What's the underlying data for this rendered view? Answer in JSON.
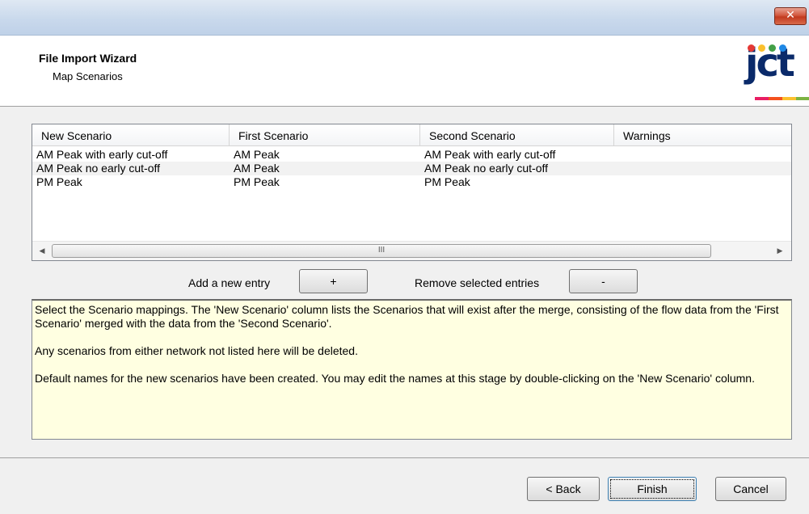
{
  "window": {
    "close_glyph": "✕"
  },
  "header": {
    "title": "File Import Wizard",
    "subtitle": "Map Scenarios"
  },
  "logo": {
    "text": "jct",
    "dot_colors": [
      "#e53935",
      "#fbc02d",
      "#43a047",
      "#1e88e5"
    ],
    "bar_colors": [
      "#e91e63",
      "#f4511e",
      "#fbc02d",
      "#7cb342"
    ]
  },
  "grid": {
    "columns": [
      "New Scenario",
      "First Scenario",
      "Second Scenario",
      "Warnings"
    ],
    "rows": [
      [
        "AM Peak with early cut-off",
        "AM Peak",
        "AM Peak with early cut-off",
        ""
      ],
      [
        "AM Peak no early cut-off",
        "AM Peak",
        "AM Peak no early cut-off",
        ""
      ],
      [
        "PM Peak",
        "PM Peak",
        "PM Peak",
        ""
      ]
    ],
    "scroll_left_icon": "◀",
    "scroll_right_icon": "▶",
    "scroll_grip": "III"
  },
  "entries": {
    "add_label": "Add a new entry",
    "add_button": "+",
    "remove_label": "Remove selected entries",
    "remove_button": "-"
  },
  "info": {
    "p1": "Select the Scenario mappings. The 'New Scenario' column lists the Scenarios that will exist after the merge, consisting of the flow data from the 'First Scenario' merged with the data from the 'Second Scenario'.",
    "p2": "Any scenarios from either network not listed here will be deleted.",
    "p3": "Default names for the new scenarios have been created. You may edit the names at this stage by double-clicking on the 'New Scenario' column."
  },
  "footer": {
    "back": "< Back",
    "finish": "Finish",
    "cancel": "Cancel"
  }
}
